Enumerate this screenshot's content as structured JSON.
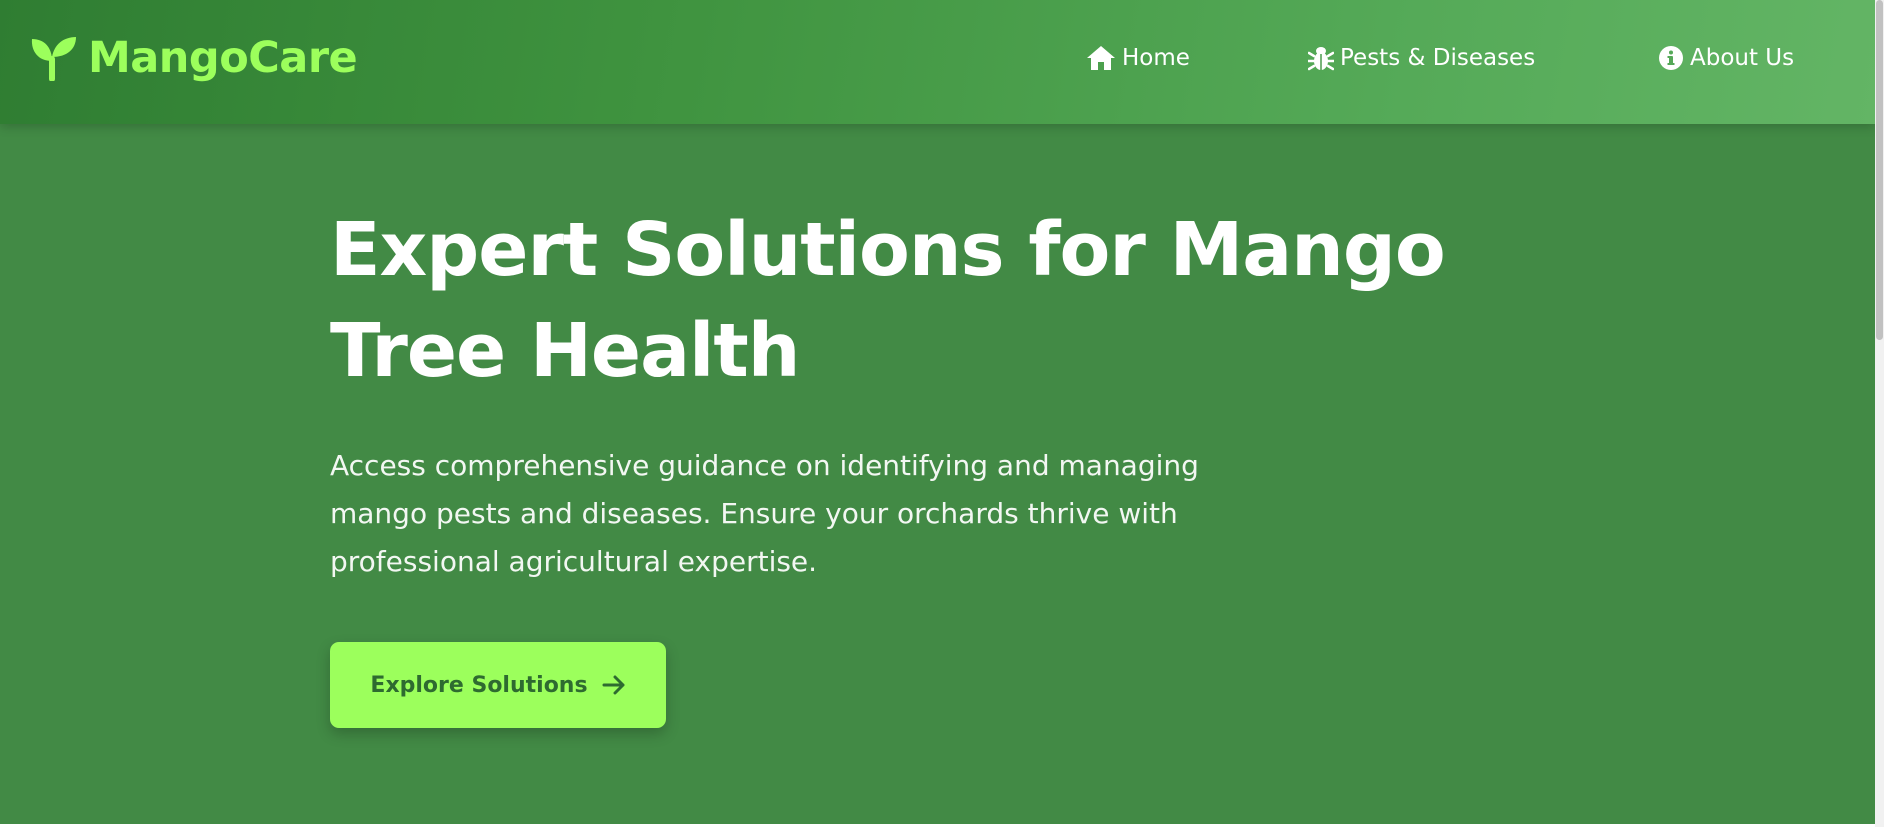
{
  "brand": {
    "name": "MangoCare",
    "icon": "seedling-icon",
    "color": "#9cff5c"
  },
  "nav": {
    "items": [
      {
        "label": "Home",
        "icon": "home-icon"
      },
      {
        "label": "Pests & Diseases",
        "icon": "bug-icon"
      },
      {
        "label": "About Us",
        "icon": "info-circle-icon"
      }
    ]
  },
  "hero": {
    "title": "Expert Solutions for Mango Tree Health",
    "description": "Access comprehensive guidance on identifying and managing mango pests and diseases. Ensure your orchards thrive with professional agricultural expertise.",
    "cta_label": "Explore Solutions",
    "cta_icon": "arrow-right-icon"
  },
  "colors": {
    "hero_background": "#428a45",
    "navbar_gradient_start": "#2f7d32",
    "navbar_gradient_end": "#63b565",
    "accent": "#9cff5c",
    "cta_text": "#2e6b30"
  }
}
